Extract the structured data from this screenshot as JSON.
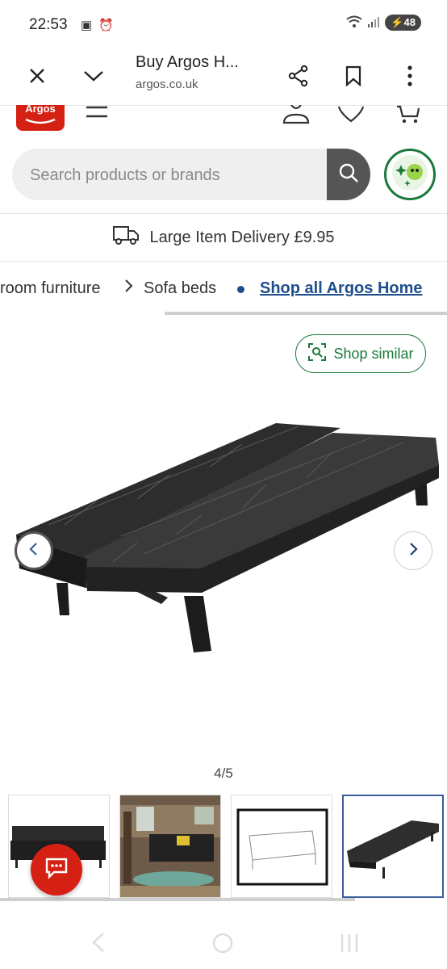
{
  "status": {
    "time": "22:53",
    "battery": "48"
  },
  "browser": {
    "title": "Buy Argos H...",
    "url": "argos.co.uk"
  },
  "header": {
    "logo": "Argos"
  },
  "search": {
    "placeholder": "Search products or brands"
  },
  "delivery": {
    "text": "Large Item Delivery £9.95"
  },
  "breadcrumb": {
    "item1": "room furniture",
    "item2": "Sofa beds",
    "link": "Shop all Argos Home"
  },
  "gallery": {
    "shop_similar": "Shop similar",
    "counter": "4/5"
  },
  "colors": {
    "brand": "#d42114",
    "accent_green": "#1a7a3a",
    "link": "#1f4e8c"
  }
}
